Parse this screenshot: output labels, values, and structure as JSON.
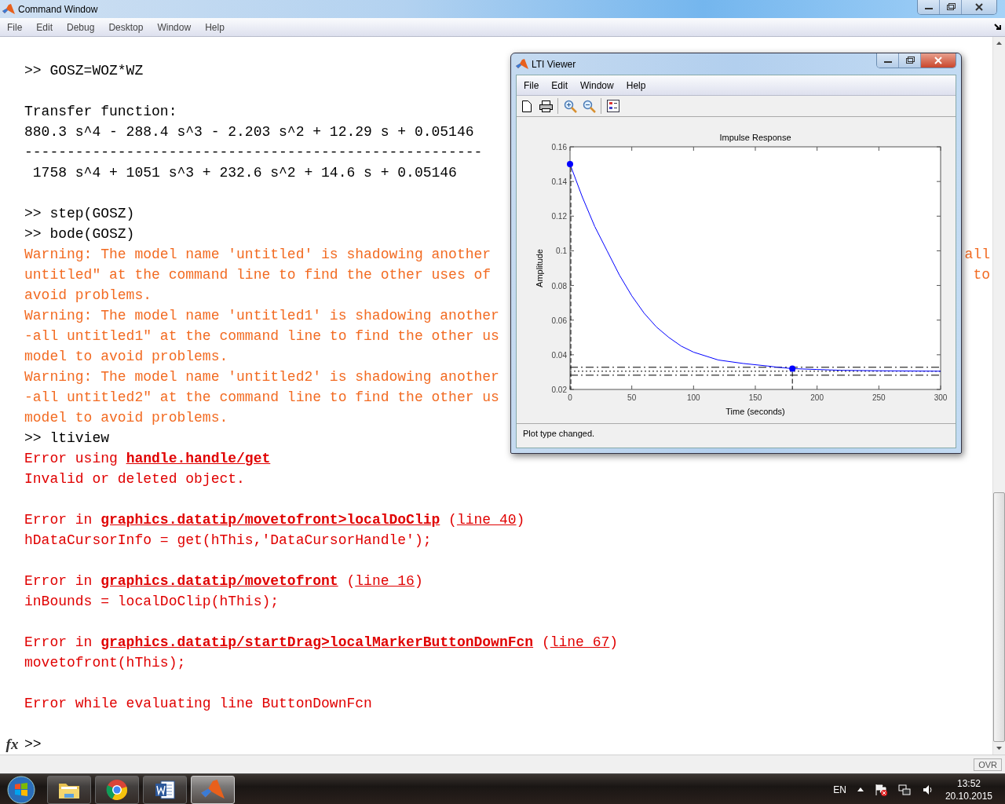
{
  "command_window": {
    "title": "Command Window",
    "menu": [
      "File",
      "Edit",
      "Debug",
      "Desktop",
      "Window",
      "Help"
    ],
    "lines": [
      {
        "kind": "input",
        "segments": [
          {
            "kind": "text",
            "text": ">> GOSZ=WOZ*WZ"
          }
        ]
      },
      {
        "kind": "blank"
      },
      {
        "kind": "output",
        "segments": [
          {
            "kind": "text",
            "text": "Transfer function:"
          }
        ]
      },
      {
        "kind": "output",
        "segments": [
          {
            "kind": "text",
            "text": "880.3 s^4 - 288.4 s^3 - 2.203 s^2 + 12.29 s + 0.05146"
          }
        ]
      },
      {
        "kind": "output",
        "segments": [
          {
            "kind": "text",
            "text": "------------------------------------------------------"
          }
        ]
      },
      {
        "kind": "output",
        "segments": [
          {
            "kind": "text",
            "text": " 1758 s^4 + 1051 s^3 + 232.6 s^2 + 14.6 s + 0.05146"
          }
        ]
      },
      {
        "kind": "blank"
      },
      {
        "kind": "input",
        "segments": [
          {
            "kind": "text",
            "text": ">> step(GOSZ)"
          }
        ]
      },
      {
        "kind": "input",
        "segments": [
          {
            "kind": "text",
            "text": ">> bode(GOSZ)"
          }
        ]
      },
      {
        "kind": "warning",
        "segments": [
          {
            "kind": "text",
            "text": "Warning: The model name 'untitled' is shadowing another"
          }
        ],
        "tail": "all"
      },
      {
        "kind": "warning",
        "segments": [
          {
            "kind": "text",
            "text": "untitled\" at the command line to find the other uses of"
          }
        ],
        "tail": "to"
      },
      {
        "kind": "warning",
        "segments": [
          {
            "kind": "text",
            "text": "avoid problems."
          }
        ]
      },
      {
        "kind": "warning",
        "segments": [
          {
            "kind": "text",
            "text": "Warning: The model name 'untitled1' is shadowing another"
          }
        ]
      },
      {
        "kind": "warning",
        "segments": [
          {
            "kind": "text",
            "text": "-all untitled1\" at the command line to find the other us"
          }
        ]
      },
      {
        "kind": "warning",
        "segments": [
          {
            "kind": "text",
            "text": "model to avoid problems."
          }
        ]
      },
      {
        "kind": "warning",
        "segments": [
          {
            "kind": "text",
            "text": "Warning: The model name 'untitled2' is shadowing another"
          }
        ]
      },
      {
        "kind": "warning",
        "segments": [
          {
            "kind": "text",
            "text": "-all untitled2\" at the command line to find the other us"
          }
        ]
      },
      {
        "kind": "warning",
        "segments": [
          {
            "kind": "text",
            "text": "model to avoid problems."
          }
        ]
      },
      {
        "kind": "input",
        "segments": [
          {
            "kind": "text",
            "text": ">> ltiview"
          }
        ]
      },
      {
        "kind": "error",
        "segments": [
          {
            "kind": "text",
            "text": "Error using "
          },
          {
            "kind": "link",
            "text": "handle.handle/get"
          }
        ]
      },
      {
        "kind": "error",
        "segments": [
          {
            "kind": "text",
            "text": "Invalid or deleted object."
          }
        ]
      },
      {
        "kind": "blank"
      },
      {
        "kind": "error",
        "segments": [
          {
            "kind": "text",
            "text": "Error in "
          },
          {
            "kind": "link",
            "text": "graphics.datatip/movetofront>localDoClip"
          },
          {
            "kind": "text",
            "text": " ("
          },
          {
            "kind": "ref",
            "text": "line 40"
          },
          {
            "kind": "text",
            "text": ")"
          }
        ]
      },
      {
        "kind": "error",
        "segments": [
          {
            "kind": "text",
            "text": "hDataCursorInfo = get(hThis,'DataCursorHandle');"
          }
        ]
      },
      {
        "kind": "blank"
      },
      {
        "kind": "error",
        "segments": [
          {
            "kind": "text",
            "text": "Error in "
          },
          {
            "kind": "link",
            "text": "graphics.datatip/movetofront"
          },
          {
            "kind": "text",
            "text": " ("
          },
          {
            "kind": "ref",
            "text": "line 16"
          },
          {
            "kind": "text",
            "text": ")"
          }
        ]
      },
      {
        "kind": "error",
        "segments": [
          {
            "kind": "text",
            "text": "inBounds = localDoClip(hThis);"
          }
        ]
      },
      {
        "kind": "blank"
      },
      {
        "kind": "error",
        "segments": [
          {
            "kind": "text",
            "text": "Error in "
          },
          {
            "kind": "link",
            "text": "graphics.datatip/startDrag>localMarkerButtonDownFcn"
          },
          {
            "kind": "text",
            "text": " ("
          },
          {
            "kind": "ref",
            "text": "line 67"
          },
          {
            "kind": "text",
            "text": ")"
          }
        ]
      },
      {
        "kind": "error",
        "segments": [
          {
            "kind": "text",
            "text": "movetofront(hThis);"
          }
        ]
      },
      {
        "kind": "blank"
      },
      {
        "kind": "error",
        "segments": [
          {
            "kind": "text",
            "text": "Error while evaluating line ButtonDownFcn"
          }
        ]
      },
      {
        "kind": "blank"
      }
    ],
    "prompt": {
      "icon_label": "fx",
      "text": ">>"
    }
  },
  "lti_viewer": {
    "title": "LTI Viewer",
    "menu": [
      "File",
      "Edit",
      "Window",
      "Help"
    ],
    "chart_data": {
      "type": "line",
      "title": "Impulse Response",
      "xlabel": "Time (seconds)",
      "ylabel": "Amplitude",
      "x": [
        0,
        10,
        20,
        30,
        40,
        50,
        60,
        70,
        80,
        90,
        100,
        120,
        140,
        160,
        168,
        180,
        200,
        220,
        250,
        300
      ],
      "series": [
        {
          "color": "#0000ff",
          "values": [
            0.15,
            0.131,
            0.114,
            0.1,
            0.086,
            0.074,
            0.064,
            0.056,
            0.05,
            0.045,
            0.0415,
            0.037,
            0.035,
            0.0335,
            0.0328,
            0.032,
            0.0315,
            0.031,
            0.0308,
            0.0305
          ]
        }
      ],
      "xlim": [
        0,
        300
      ],
      "ylim": [
        0.02,
        0.16
      ],
      "xticks": [
        0,
        50,
        100,
        150,
        200,
        250,
        300
      ],
      "yticks": [
        0.02,
        0.04,
        0.06,
        0.08,
        0.1,
        0.12,
        0.14,
        0.16
      ]
    },
    "status": "Plot type changed."
  },
  "status_bar": {
    "mode": "OVR"
  },
  "taskbar": {
    "apps": [
      {
        "kind": "explorer",
        "selected": false
      },
      {
        "kind": "browser",
        "selected": false
      },
      {
        "kind": "word",
        "selected": false
      },
      {
        "kind": "matlab",
        "selected": true
      }
    ],
    "language": "EN",
    "time": "13:52",
    "date": "20.10.2015"
  }
}
